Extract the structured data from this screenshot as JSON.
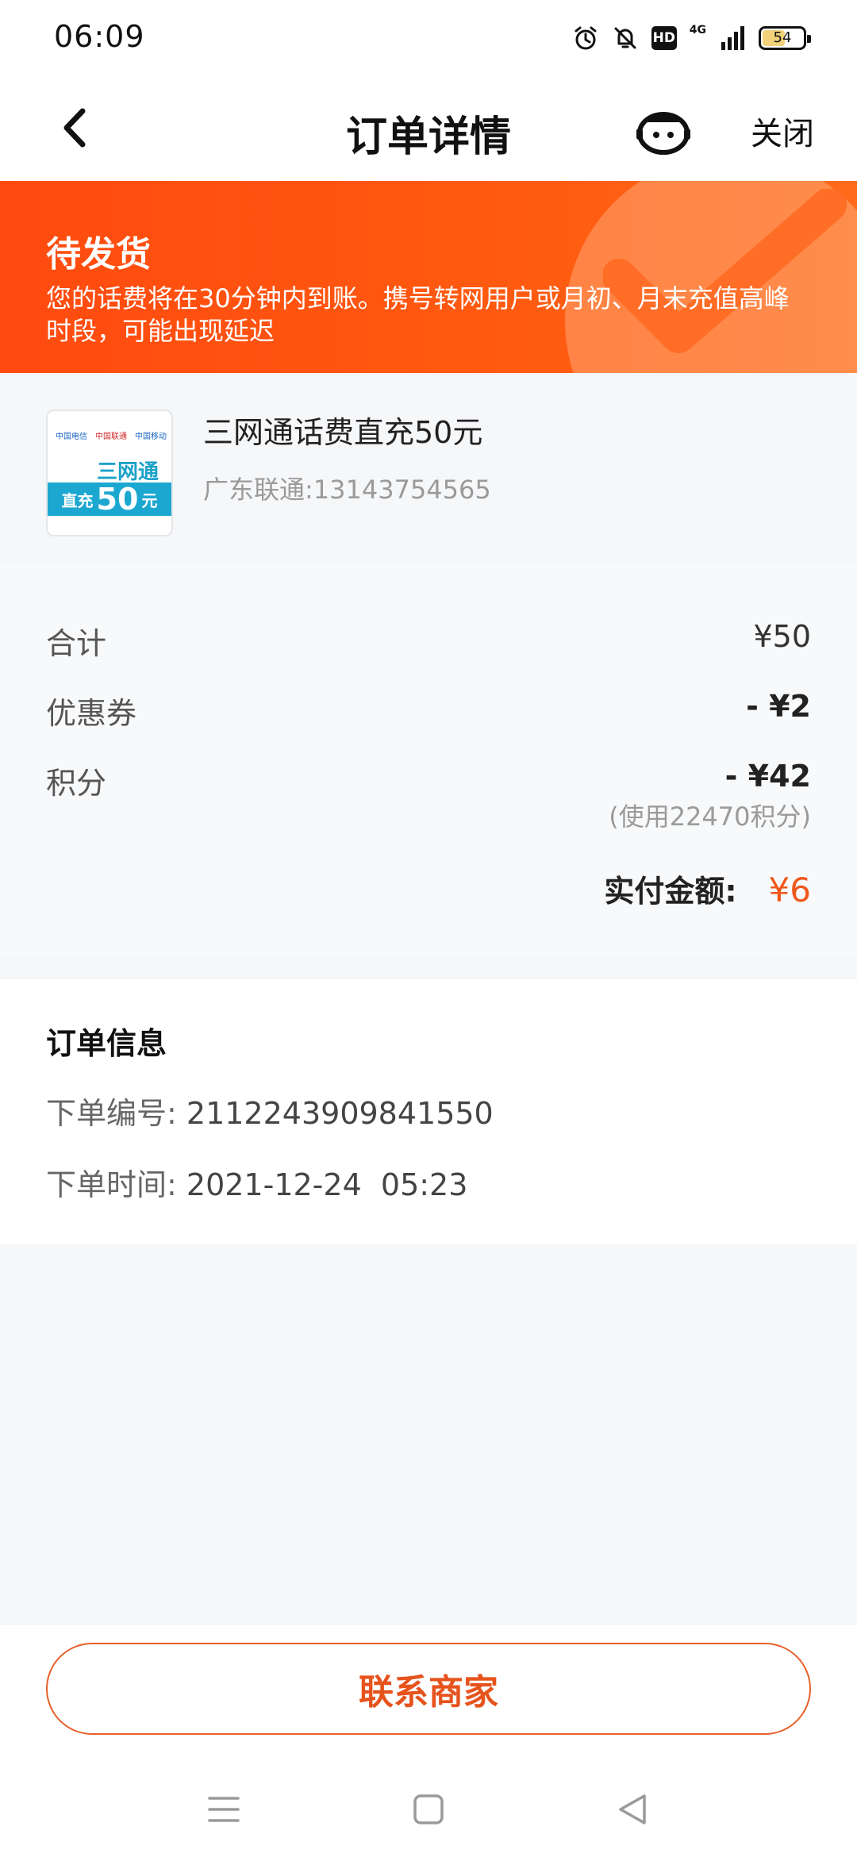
{
  "status_bar": {
    "time": "06:09",
    "hd_label": "HD",
    "network_label": "4G",
    "battery_level": "54"
  },
  "nav": {
    "title": "订单详情",
    "close_label": "关闭"
  },
  "banner": {
    "status": "待发货",
    "description": "您的话费将在30分钟内到账。携号转网用户或月初、月末充值高峰时段，可能出现延迟",
    "color": "#ff4a0f"
  },
  "product": {
    "thumbnail": {
      "logos": [
        "中国电信",
        "中国联通",
        "中国移动"
      ],
      "top_text": "三网通",
      "band_prefix": "直充",
      "band_amount": "50",
      "band_suffix": "元"
    },
    "name": "三网通话费直充50元",
    "subtitle": "广东联通:13143754565"
  },
  "price": {
    "total_label": "合计",
    "total_value": "¥50",
    "coupon_label": "优惠券",
    "coupon_value": "- ¥2",
    "points_label": "积分",
    "points_value": "- ¥42",
    "points_note": "(使用22470积分)",
    "paid_label": "实付金额:",
    "paid_value": "¥6",
    "accent_color": "#f0571b"
  },
  "order_info": {
    "title": "订单信息",
    "order_no_label": "下单编号:",
    "order_no_value": "2112243909841550",
    "order_time_label": "下单时间:",
    "order_time_value": "2021-12-24  05:23"
  },
  "actions": {
    "contact_label": "联系商家"
  },
  "icons": {
    "back": "chevron-left-icon",
    "customer_service": "robot-face-icon",
    "alarm": "alarm-icon",
    "mute": "bell-off-icon",
    "signal": "signal-icon",
    "battery": "battery-icon",
    "check": "check-icon",
    "menu": "menu-icon",
    "home": "home-icon",
    "back_triangle": "back-triangle-icon"
  }
}
